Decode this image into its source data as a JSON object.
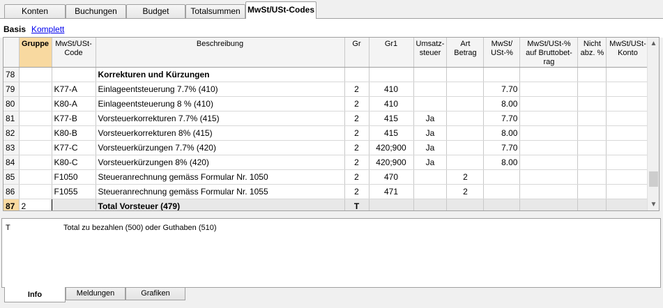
{
  "top_tabs": [
    {
      "label": "Konten"
    },
    {
      "label": "Buchungen"
    },
    {
      "label": "Budget"
    },
    {
      "label": "Totalsummen"
    },
    {
      "label": "MwSt/USt-Codes"
    }
  ],
  "views": {
    "basis": "Basis",
    "komplett": "Komplett"
  },
  "columns": [
    "",
    "Gruppe",
    "MwSt/USt-Code",
    "Beschreibung",
    "Gr",
    "Gr1",
    "Umsatz-steuer",
    "Art Betrag",
    "MwSt/ USt-%",
    "MwSt/USt-% auf Bruttobet-rag",
    "Nicht abz. %",
    "MwSt/USt-Konto"
  ],
  "rows": [
    {
      "num": "78",
      "gruppe": "",
      "code": "",
      "beschreibung": "Korrekturen und Kürzungen",
      "gr": "",
      "gr1": "",
      "umsatz": "",
      "art": "",
      "pct": "",
      "brutto": "",
      "nicht": "",
      "konto": "",
      "bold": true
    },
    {
      "num": "79",
      "gruppe": "",
      "code": "K77-A",
      "beschreibung": "Einlageentsteuerung  7.7% (410)",
      "gr": "2",
      "gr1": "410",
      "umsatz": "",
      "art": "",
      "pct": "7.70",
      "brutto": "",
      "nicht": "",
      "konto": ""
    },
    {
      "num": "80",
      "gruppe": "",
      "code": "K80-A",
      "beschreibung": "Einlageentsteuerung  8 % (410)",
      "gr": "2",
      "gr1": "410",
      "umsatz": "",
      "art": "",
      "pct": "8.00",
      "brutto": "",
      "nicht": "",
      "konto": ""
    },
    {
      "num": "81",
      "gruppe": "",
      "code": "K77-B",
      "beschreibung": "Vorsteuerkorrekturen 7.7% (415)",
      "gr": "2",
      "gr1": "415",
      "umsatz": "Ja",
      "art": "",
      "pct": "7.70",
      "brutto": "",
      "nicht": "",
      "konto": ""
    },
    {
      "num": "82",
      "gruppe": "",
      "code": "K80-B",
      "beschreibung": "Vorsteuerkorrekturen 8% (415)",
      "gr": "2",
      "gr1": "415",
      "umsatz": "Ja",
      "art": "",
      "pct": "8.00",
      "brutto": "",
      "nicht": "",
      "konto": ""
    },
    {
      "num": "83",
      "gruppe": "",
      "code": "K77-C",
      "beschreibung": "Vorsteuerkürzungen 7.7% (420)",
      "gr": "2",
      "gr1": "420;900",
      "umsatz": "Ja",
      "art": "",
      "pct": "7.70",
      "brutto": "",
      "nicht": "",
      "konto": ""
    },
    {
      "num": "84",
      "gruppe": "",
      "code": "K80-C",
      "beschreibung": "Vorsteuerkürzungen 8% (420)",
      "gr": "2",
      "gr1": "420;900",
      "umsatz": "Ja",
      "art": "",
      "pct": "8.00",
      "brutto": "",
      "nicht": "",
      "konto": ""
    },
    {
      "num": "85",
      "gruppe": "",
      "code": "F1050",
      "beschreibung": "Steueranrechnung gemäss Formular Nr. 1050",
      "gr": "2",
      "gr1": "470",
      "umsatz": "",
      "art": "2",
      "pct": "",
      "brutto": "",
      "nicht": "",
      "konto": ""
    },
    {
      "num": "86",
      "gruppe": "",
      "code": "F1055",
      "beschreibung": "Steueranrechnung gemäss Formular Nr. 1055",
      "gr": "2",
      "gr1": "471",
      "umsatz": "",
      "art": "2",
      "pct": "",
      "brutto": "",
      "nicht": "",
      "konto": ""
    },
    {
      "num": "87",
      "gruppe": "2",
      "code": "",
      "beschreibung": "Total Vorsteuer (479)",
      "gr": "T",
      "gr1": "",
      "umsatz": "",
      "art": "",
      "pct": "",
      "brutto": "",
      "nicht": "",
      "konto": "",
      "total": true
    }
  ],
  "info": {
    "code": "T",
    "text": "Total zu bezahlen (500) oder Guthaben (510)"
  },
  "bottom_tabs": [
    {
      "label": "Info"
    },
    {
      "label": "Meldungen"
    },
    {
      "label": "Grafiken"
    }
  ],
  "colors": {
    "selected_header": "#f8d9a0",
    "total_row": "#e8e8e8",
    "link": "#0000ee"
  },
  "icons": {
    "scroll_up": "chevron-up-icon",
    "scroll_down": "chevron-down-icon"
  }
}
